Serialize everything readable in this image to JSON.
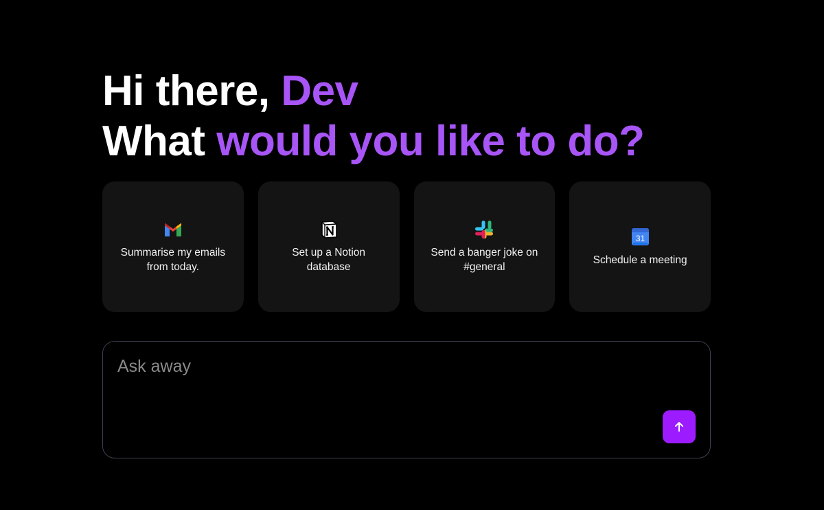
{
  "greeting": {
    "prefix": "Hi there, ",
    "name": "Dev",
    "question_lead": "What ",
    "question_accent": "would you like to do?"
  },
  "colors": {
    "background": "#000000",
    "accent": "#a855f7",
    "card_bg": "#141414",
    "send_button": "#9d1cff",
    "composer_border": "#3d4150"
  },
  "suggestions": [
    {
      "icon": "gmail-icon",
      "label": "Summarise my emails\nfrom today."
    },
    {
      "icon": "notion-icon",
      "label": "Set up a Notion\ndatabase"
    },
    {
      "icon": "slack-icon",
      "label": "Send a banger joke on\n#general"
    },
    {
      "icon": "google-calendar-icon",
      "label": "Schedule a meeting",
      "calendar_day": "31"
    }
  ],
  "composer": {
    "placeholder": "Ask away",
    "value": "",
    "send_icon": "arrow-up-icon"
  }
}
